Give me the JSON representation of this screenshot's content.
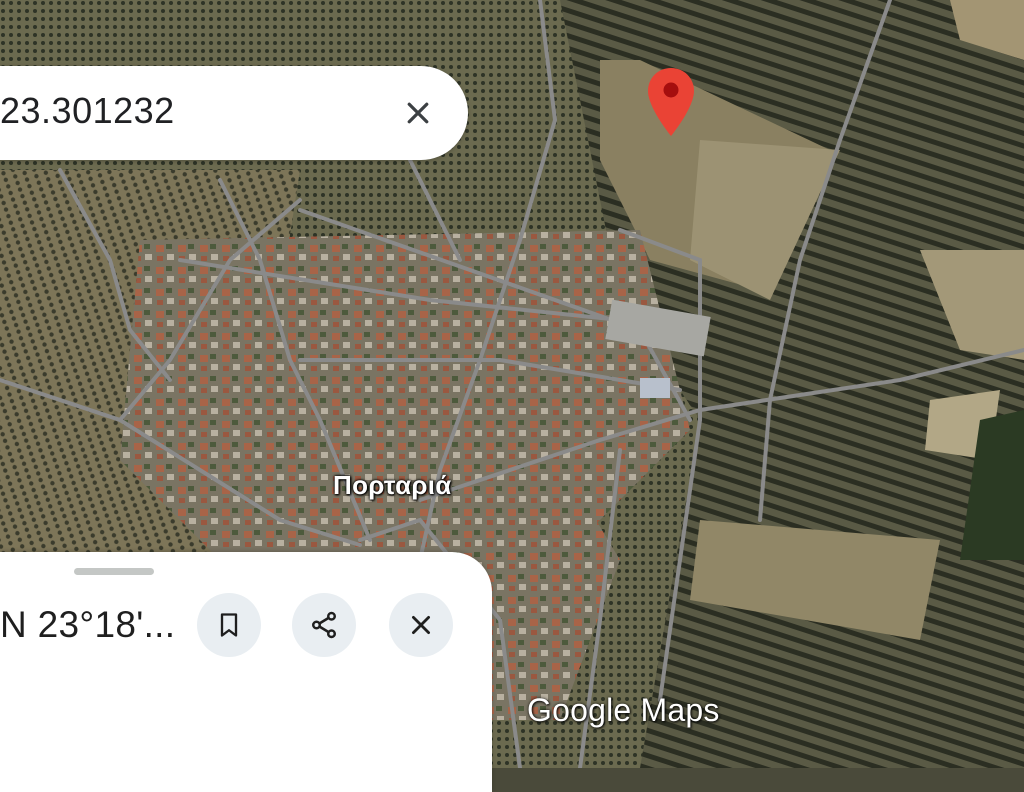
{
  "search": {
    "query_text": "23.301232",
    "clear_icon": "close-icon"
  },
  "map": {
    "type": "satellite",
    "place_label": "Πορταριά",
    "watermark": "Google Maps",
    "pin_color": "#ea4335"
  },
  "bottom_sheet": {
    "title": "N 23°18'...",
    "buttons": [
      {
        "icon": "bookmark-icon"
      },
      {
        "icon": "share-icon"
      },
      {
        "icon": "close-icon"
      }
    ]
  },
  "colors": {
    "field_dark": "#2f3326",
    "field_light": "#8d8363",
    "road": "#7a7a7a",
    "roof": "#a0593e",
    "button_bg": "#e9eef2"
  }
}
